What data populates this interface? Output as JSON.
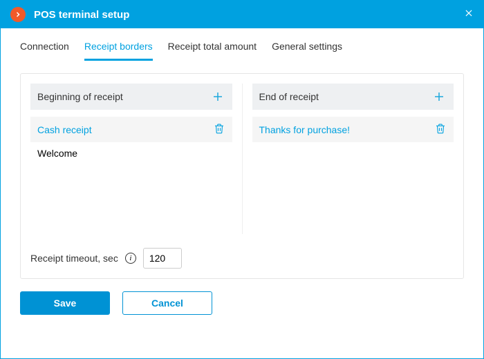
{
  "header": {
    "title": "POS terminal setup"
  },
  "tabs": [
    {
      "label": "Connection"
    },
    {
      "label": "Receipt borders"
    },
    {
      "label": "Receipt total amount"
    },
    {
      "label": "General settings"
    }
  ],
  "active_tab": 1,
  "receipt_borders": {
    "beginning": {
      "title": "Beginning of receipt",
      "items": [
        {
          "label": "Cash receipt",
          "selected": true
        },
        {
          "label": "Welcome",
          "selected": false
        }
      ]
    },
    "end": {
      "title": "End of receipt",
      "items": [
        {
          "label": "Thanks for purchase!",
          "selected": true
        }
      ]
    },
    "timeout": {
      "label": "Receipt timeout, sec",
      "value": "120"
    }
  },
  "buttons": {
    "save": "Save",
    "cancel": "Cancel"
  }
}
